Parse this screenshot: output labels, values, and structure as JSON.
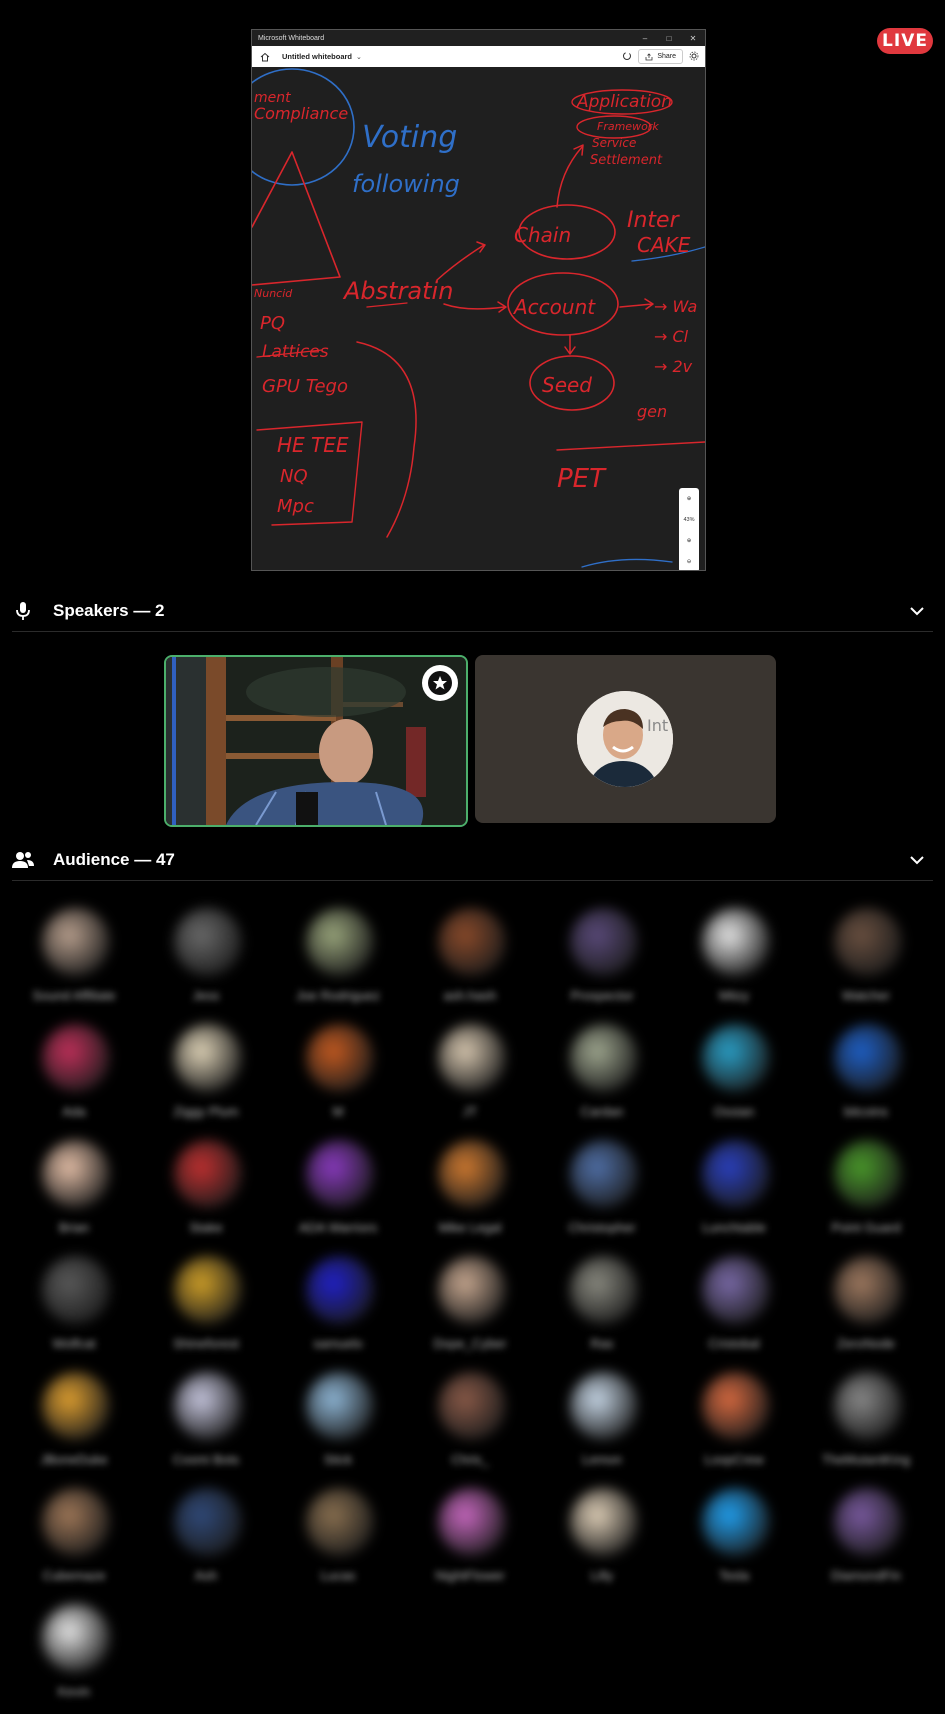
{
  "live_badge": "LIVE",
  "whiteboard": {
    "window_title": "Microsoft Whiteboard",
    "board_name": "Untitled whiteboard",
    "share_label": "Share",
    "zoom_level": "43%",
    "ink": {
      "compliance": "Compliance",
      "voting": "Voting",
      "following": "following",
      "chain": "Chain",
      "intercake": "Inter",
      "cake": "CAKE",
      "abstraction": "Abstratin",
      "account": "Account",
      "seed": "Seed",
      "pet": "PET",
      "pq": "PQ",
      "lattices": "Lattices",
      "gpu": "GPU Tego",
      "he_tee": "HE TEE",
      "nq": "NQ",
      "mpc": "Mpc",
      "gen": "gen",
      "application": "Application",
      "framework": "Framework",
      "service": "Service",
      "settlement": "Settlement",
      "nuncid": "Nuncid"
    }
  },
  "speakers": {
    "title": "Speakers — 2"
  },
  "audience": {
    "title": "Audience — 47",
    "members": [
      {
        "name": "Sound Affiliate",
        "color": "#b9a08e"
      },
      {
        "name": "Jess",
        "color": "#6a6a6a"
      },
      {
        "name": "Joe Rodriguez",
        "color": "#9aa67c"
      },
      {
        "name": "ash.hash",
        "color": "#8a4a2a"
      },
      {
        "name": "Prospector",
        "color": "#5a4a7a"
      },
      {
        "name": "Mitzy",
        "color": "#e8e8e8"
      },
      {
        "name": "Watcher",
        "color": "#6a5040"
      },
      {
        "name": "Ada",
        "color": "#c0305a"
      },
      {
        "name": "Ziggy Plum",
        "color": "#e0d4b8"
      },
      {
        "name": "M",
        "color": "#c45a20"
      },
      {
        "name": "JT",
        "color": "#d8c8b0"
      },
      {
        "name": "Cardan",
        "color": "#a0a890"
      },
      {
        "name": "Ossian",
        "color": "#2aa0c8"
      },
      {
        "name": "bitcoins",
        "color": "#1e60c8"
      },
      {
        "name": "Brian",
        "color": "#e6c0a8"
      },
      {
        "name": "Stake",
        "color": "#c03030"
      },
      {
        "name": "ADA Warriors",
        "color": "#8a3ac0"
      },
      {
        "name": "Mike Legal",
        "color": "#d07a30"
      },
      {
        "name": "Christopher",
        "color": "#5070a8"
      },
      {
        "name": "Lunchtable",
        "color": "#2a40c0"
      },
      {
        "name": "Point Guard",
        "color": "#4a9a2a"
      },
      {
        "name": "Wolfcat",
        "color": "#5a5a5a"
      },
      {
        "name": "Shineforest",
        "color": "#d0a028"
      },
      {
        "name": "samuelo",
        "color": "#2020c8"
      },
      {
        "name": "Dope_Cyber",
        "color": "#c8a890"
      },
      {
        "name": "Ras",
        "color": "#8a8a80"
      },
      {
        "name": "Cristobal",
        "color": "#7a6aa8"
      },
      {
        "name": "ZeroNode",
        "color": "#a07a60"
      },
      {
        "name": "JBoneDuke",
        "color": "#e0a030"
      },
      {
        "name": "Cosmi Bots",
        "color": "#c8c8e0"
      },
      {
        "name": "Stick",
        "color": "#90b8d8"
      },
      {
        "name": "Chris_",
        "color": "#8a5a48"
      },
      {
        "name": "Lemon",
        "color": "#c8d8e8"
      },
      {
        "name": "LoopCrew",
        "color": "#d86a40"
      },
      {
        "name": "TheMutantKing",
        "color": "#8a8a8a"
      },
      {
        "name": "Cubemaze",
        "color": "#a07858"
      },
      {
        "name": "Ash",
        "color": "#304a7a"
      },
      {
        "name": "Lucas",
        "color": "#8a7050"
      },
      {
        "name": "NightFlower",
        "color": "#c868c0"
      },
      {
        "name": "Lilly",
        "color": "#e0d0b8"
      },
      {
        "name": "Tesla",
        "color": "#20a0f0"
      },
      {
        "name": "DiamondFin",
        "color": "#7a5aa0"
      },
      {
        "name": "Kevin",
        "color": "#e8e8e8"
      }
    ]
  }
}
